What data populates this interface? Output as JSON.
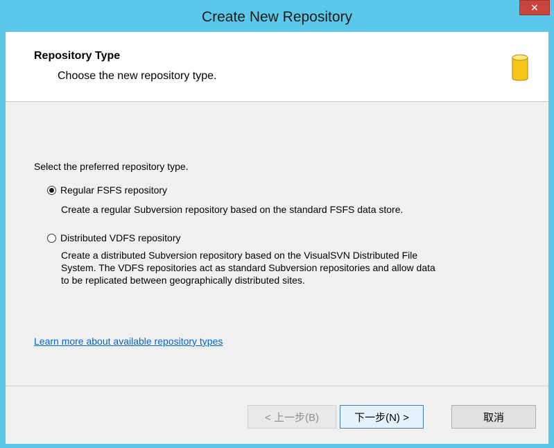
{
  "window": {
    "title": "Create New Repository"
  },
  "header": {
    "title": "Repository Type",
    "subtitle": "Choose the new repository type."
  },
  "content": {
    "prompt": "Select the preferred repository type.",
    "options": [
      {
        "label": "Regular FSFS repository",
        "selected": true,
        "description_lines": [
          "Create a regular Subversion repository based on the standard FSFS data store."
        ]
      },
      {
        "label": "Distributed VDFS repository",
        "selected": false,
        "description_lines": [
          "Create a distributed Subversion repository based on the VisualSVN Distributed File",
          "System. The VDFS repositories act as standard Subversion repositories and allow data",
          "to be replicated between geographically distributed sites."
        ]
      }
    ],
    "learn_more_link": "Learn more about available repository types"
  },
  "buttons": {
    "back": "< 上一步(B)",
    "next": "下一步(N) >",
    "cancel": "取消"
  },
  "icons": {
    "close": "close-icon",
    "repository": "database-icon"
  },
  "colors": {
    "titlebar": "#5bc8ea",
    "close": "#c8453c",
    "link": "#0066cc",
    "db_icon": "#f5c518"
  }
}
